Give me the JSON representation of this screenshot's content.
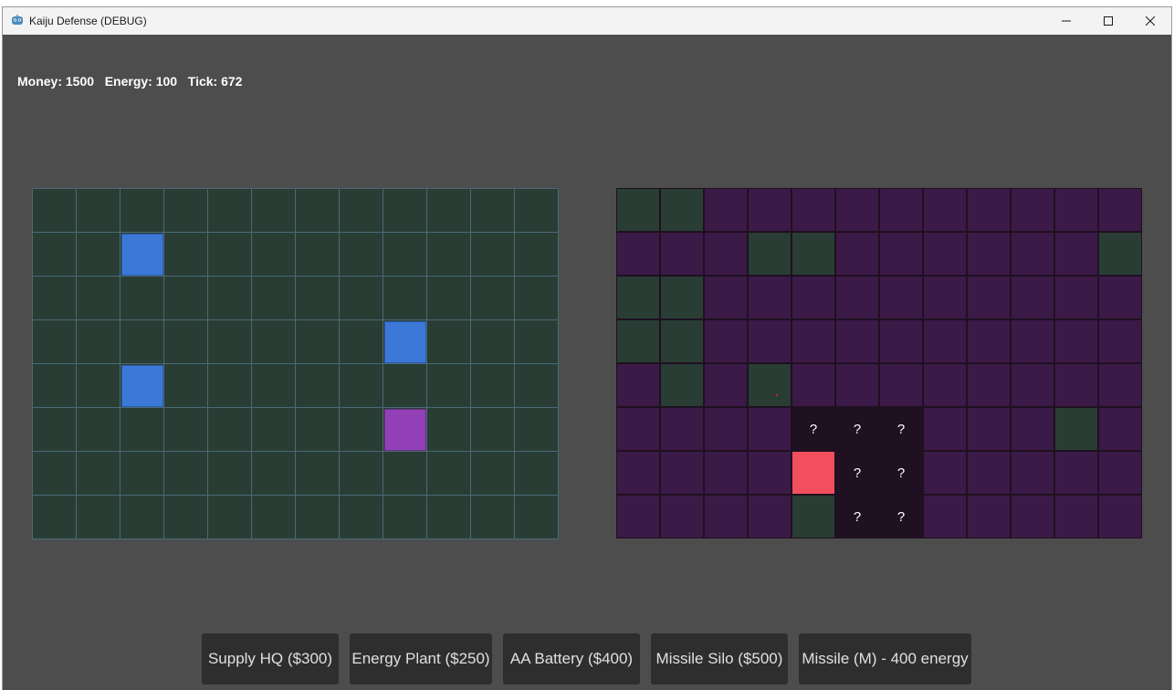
{
  "window": {
    "title": "Kaiju Defense (DEBUG)",
    "icon": "godot-robot-icon",
    "controls": [
      "minimize-icon",
      "maximize-icon",
      "close-icon"
    ]
  },
  "hud": {
    "money_label": "Money: 1500",
    "energy_label": "Energy: 100",
    "tick_label": "Tick: 672"
  },
  "player_board": {
    "rows": 8,
    "cols": 12,
    "buildings": [
      {
        "row": 1,
        "col": 2,
        "kind": "blue"
      },
      {
        "row": 3,
        "col": 8,
        "kind": "blue"
      },
      {
        "row": 4,
        "col": 2,
        "kind": "blue"
      },
      {
        "row": 5,
        "col": 8,
        "kind": "purple"
      }
    ]
  },
  "enemy_board": {
    "rows": 8,
    "cols": 12,
    "legend": {
      "F": "fog",
      "C": "clear",
      "Q": "unknown",
      "E": "enemy"
    },
    "grid": [
      "CCFFFFFFFFFF",
      "FFFCCFFFFFFC",
      "CCFFFFFFFFFF",
      "CCFFFFFFFFFF",
      "FCFCFFFFFFFF",
      "FFFFQQQFFFCF",
      "FFFFEQQFFFFF",
      "FFFFCQQFFFFF"
    ],
    "unknown_mark": "?",
    "ping": {
      "row": 4,
      "col": 3
    }
  },
  "toolbar": {
    "buttons": [
      "Supply HQ ($300)",
      "Energy Plant ($250)",
      "AA Battery ($400)",
      "Missile Silo ($500)",
      "Missile (M) - 400 energy"
    ]
  },
  "colors": {
    "background": "#4d4d4d",
    "grass": "#293d35",
    "fog": "#3b1a47",
    "unknown": "#1f1022",
    "enemy": "#f14f5d",
    "building_blue": "#3b78d8",
    "building_purple": "#9140b5"
  }
}
